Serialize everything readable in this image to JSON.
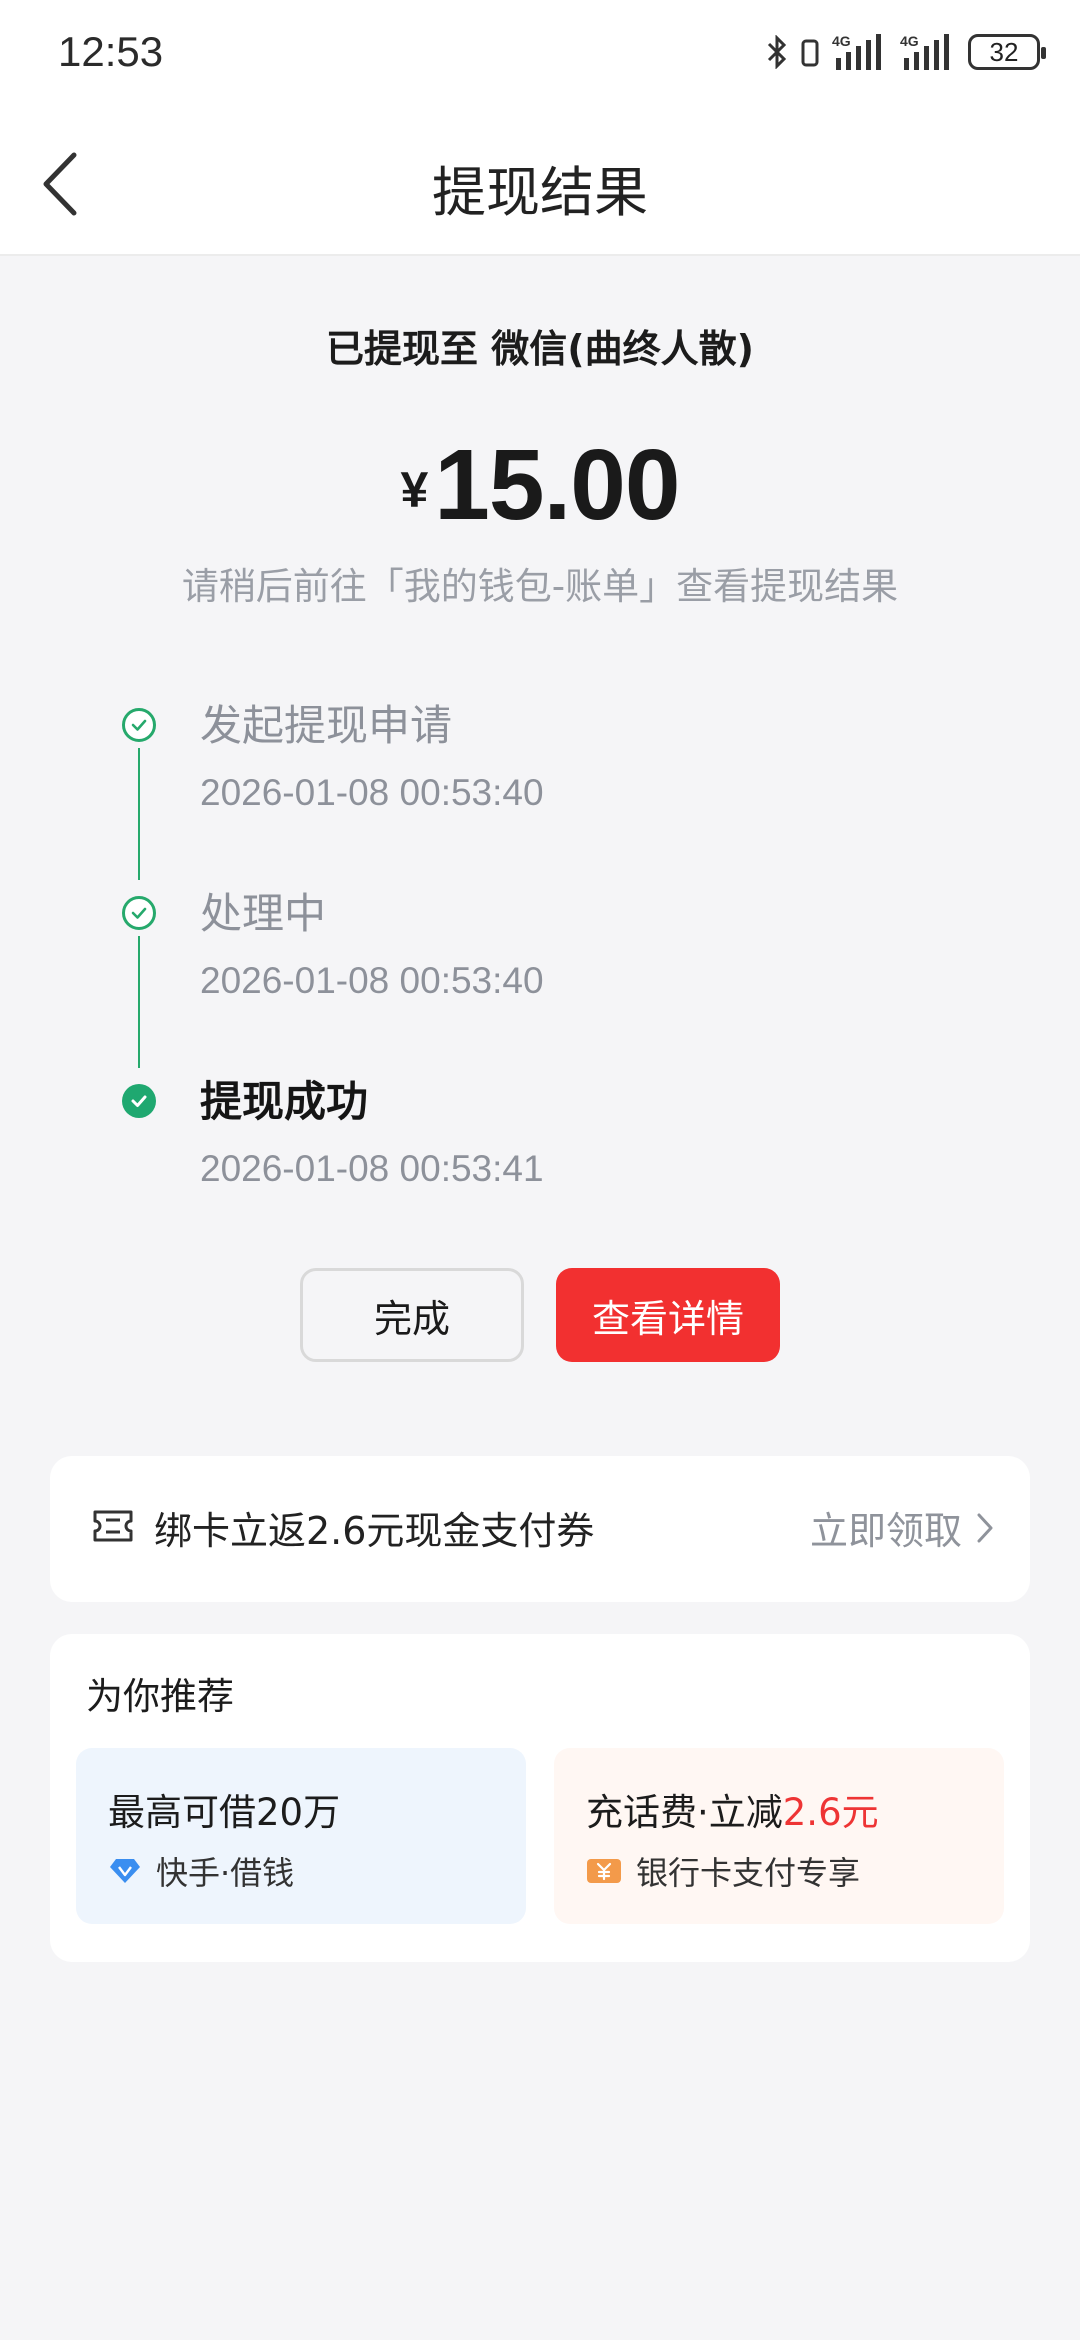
{
  "status_bar": {
    "time": "12:53",
    "battery": "32"
  },
  "nav": {
    "title": "提现结果"
  },
  "result": {
    "destination": "已提现至 微信(曲终人散)",
    "currency": "¥",
    "amount": "15.00",
    "hint": "请稍后前往「我的钱包-账单」查看提现结果"
  },
  "steps": [
    {
      "label": "发起提现申请",
      "time": "2026-01-08 00:53:40",
      "state": "done"
    },
    {
      "label": "处理中",
      "time": "2026-01-08 00:53:40",
      "state": "done"
    },
    {
      "label": "提现成功",
      "time": "2026-01-08 00:53:41",
      "state": "success"
    }
  ],
  "buttons": {
    "done": "完成",
    "detail": "查看详情"
  },
  "promo": {
    "text": "绑卡立返2.6元现金支付券",
    "action": "立即领取"
  },
  "recommend": {
    "title": "为你推荐",
    "items": [
      {
        "title": "最高可借20万",
        "sub": "快手·借钱"
      },
      {
        "title_prefix": "充话费·立减",
        "title_highlight": "2.6元",
        "sub": "银行卡支付专享"
      }
    ]
  },
  "colors": {
    "accent_red": "#f23030",
    "success_green": "#1fa870"
  }
}
